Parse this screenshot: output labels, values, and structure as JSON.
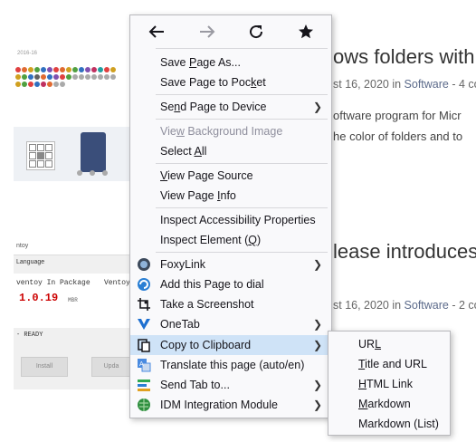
{
  "background": {
    "articles": [
      {
        "title": "ows folders with",
        "meta_prefix": "st 16, 2020 in ",
        "meta_category": "Software",
        "meta_suffix": " - 4 co",
        "body": [
          "oftware program for Micr",
          "he color of folders and to"
        ]
      },
      {
        "title": "lease introduces",
        "meta_prefix": "st 16, 2020 in ",
        "meta_category": "Software",
        "meta_suffix": " - 2 co",
        "body": [
          "og",
          "u"
        ]
      }
    ],
    "thumb1": {
      "date": "2016-16"
    },
    "thumb2": {
      "window_title": "ntoy",
      "language": "Language",
      "package": "ventoy In Package",
      "version": "1.0.19",
      "mbr": "MBR",
      "ventoy_device": "Ventoy",
      "status": "- READY",
      "install": "Install",
      "update": "Upda"
    }
  },
  "menu": {
    "nav": {
      "back": "back",
      "forward": "forward",
      "reload": "reload",
      "bookmark": "bookmark"
    },
    "items": [
      {
        "pre": "Save ",
        "key": "P",
        "post": "age As...",
        "submenu": false
      },
      {
        "pre": "Save Page to Poc",
        "key": "k",
        "post": "et",
        "submenu": false
      },
      {
        "pre": "Se",
        "key": "n",
        "post": "d Page to Device",
        "submenu": true
      },
      {
        "pre": "Vie",
        "key": "w",
        "post": " Background Image",
        "submenu": false,
        "disabled": true
      },
      {
        "pre": "Select ",
        "key": "A",
        "post": "ll",
        "submenu": false
      },
      {
        "pre": "",
        "key": "V",
        "post": "iew Page Source",
        "submenu": false
      },
      {
        "pre": "View Page ",
        "key": "I",
        "post": "nfo",
        "submenu": false
      },
      {
        "pre": "Inspect Accessibility Properties",
        "key": "",
        "post": "",
        "submenu": false
      },
      {
        "pre": "Inspect Element (",
        "key": "Q",
        "post": ")",
        "submenu": false
      },
      {
        "pre": "FoxyLink",
        "key": "",
        "post": "",
        "submenu": true,
        "icon": "foxylink-icon"
      },
      {
        "pre": "Add this Page to dial",
        "key": "",
        "post": "",
        "submenu": false,
        "icon": "speed-dial-icon"
      },
      {
        "pre": "Take a Screenshot",
        "key": "",
        "post": "",
        "submenu": false,
        "icon": "screenshot-icon"
      },
      {
        "pre": "OneTab",
        "key": "",
        "post": "",
        "submenu": true,
        "icon": "onetab-icon"
      },
      {
        "pre": "Copy to Clipboard",
        "key": "",
        "post": "",
        "submenu": true,
        "icon": "clipboard-icon",
        "highlighted": true
      },
      {
        "pre": "Translate this page (auto/en)",
        "key": "",
        "post": "",
        "submenu": false,
        "icon": "translate-icon"
      },
      {
        "pre": "Send Tab to...",
        "key": "",
        "post": "",
        "submenu": true,
        "icon": "send-tab-icon"
      },
      {
        "pre": "IDM Integration Module",
        "key": "",
        "post": "",
        "submenu": true,
        "icon": "idm-icon"
      }
    ]
  },
  "submenu": {
    "items": [
      {
        "pre": "UR",
        "key": "L",
        "post": ""
      },
      {
        "pre": "",
        "key": "T",
        "post": "itle and URL"
      },
      {
        "pre": "",
        "key": "H",
        "post": "TML Link"
      },
      {
        "pre": "",
        "key": "M",
        "post": "arkdown"
      },
      {
        "pre": "Markdown (List)",
        "key": "",
        "post": ""
      }
    ]
  },
  "colors": {
    "highlight": "#cfe3f7",
    "menu_bg": "#f9f9fb"
  }
}
